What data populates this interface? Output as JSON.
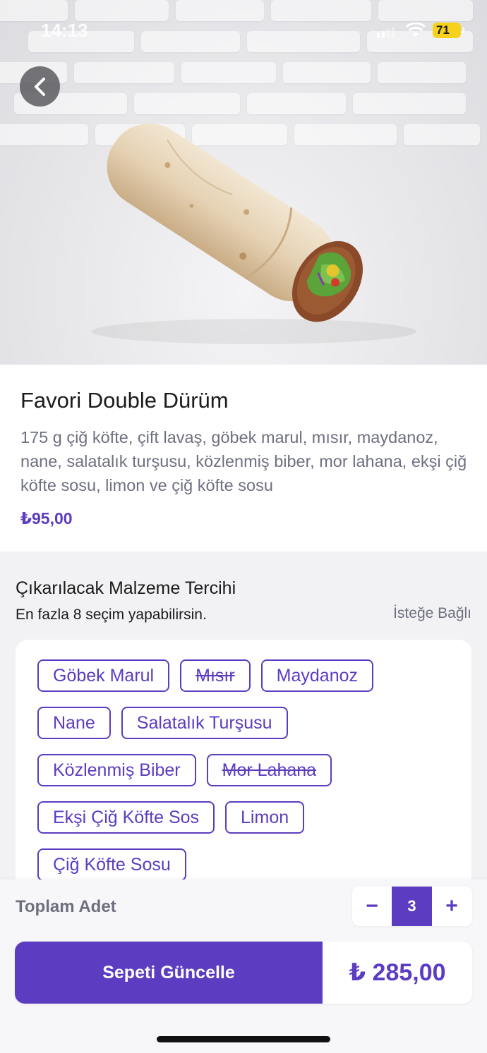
{
  "status_bar": {
    "time": "14:13",
    "battery": "71"
  },
  "product": {
    "name": "Favori Double Dürüm",
    "description": "175 g çiğ köfte, çift lavaş, göbek marul, mısır, maydanoz, nane, salatalık turşusu, közlenmiş biber, mor lahana, ekşi çiğ köfte sosu, limon ve çiğ köfte sosu",
    "price": "₺95,00"
  },
  "removal": {
    "title": "Çıkarılacak Malzeme Tercihi",
    "subtitle": "En fazla 8 seçim yapabilirsin.",
    "optional_label": "İsteğe Bağlı",
    "chips": [
      {
        "label": "Göbek Marul",
        "removed": false
      },
      {
        "label": "Mısır",
        "removed": true
      },
      {
        "label": "Maydanoz",
        "removed": false
      },
      {
        "label": "Nane",
        "removed": false
      },
      {
        "label": "Salatalık Turşusu",
        "removed": false
      },
      {
        "label": "Közlenmiş Biber",
        "removed": false
      },
      {
        "label": "Mor Lahana",
        "removed": true
      },
      {
        "label": "Ekşi Çiğ Köfte Sos",
        "removed": false
      },
      {
        "label": "Limon",
        "removed": false
      },
      {
        "label": "Çiğ Köfte Sosu",
        "removed": false
      }
    ]
  },
  "footer": {
    "total_label": "Toplam Adet",
    "minus": "−",
    "quantity": "3",
    "plus": "+",
    "update_button": "Sepeti Güncelle",
    "total_price": "₺ 285,00"
  },
  "colors": {
    "accent": "#5c3cc0",
    "muted": "#6e7080"
  },
  "icons": {
    "back": "chevron-left-icon"
  }
}
